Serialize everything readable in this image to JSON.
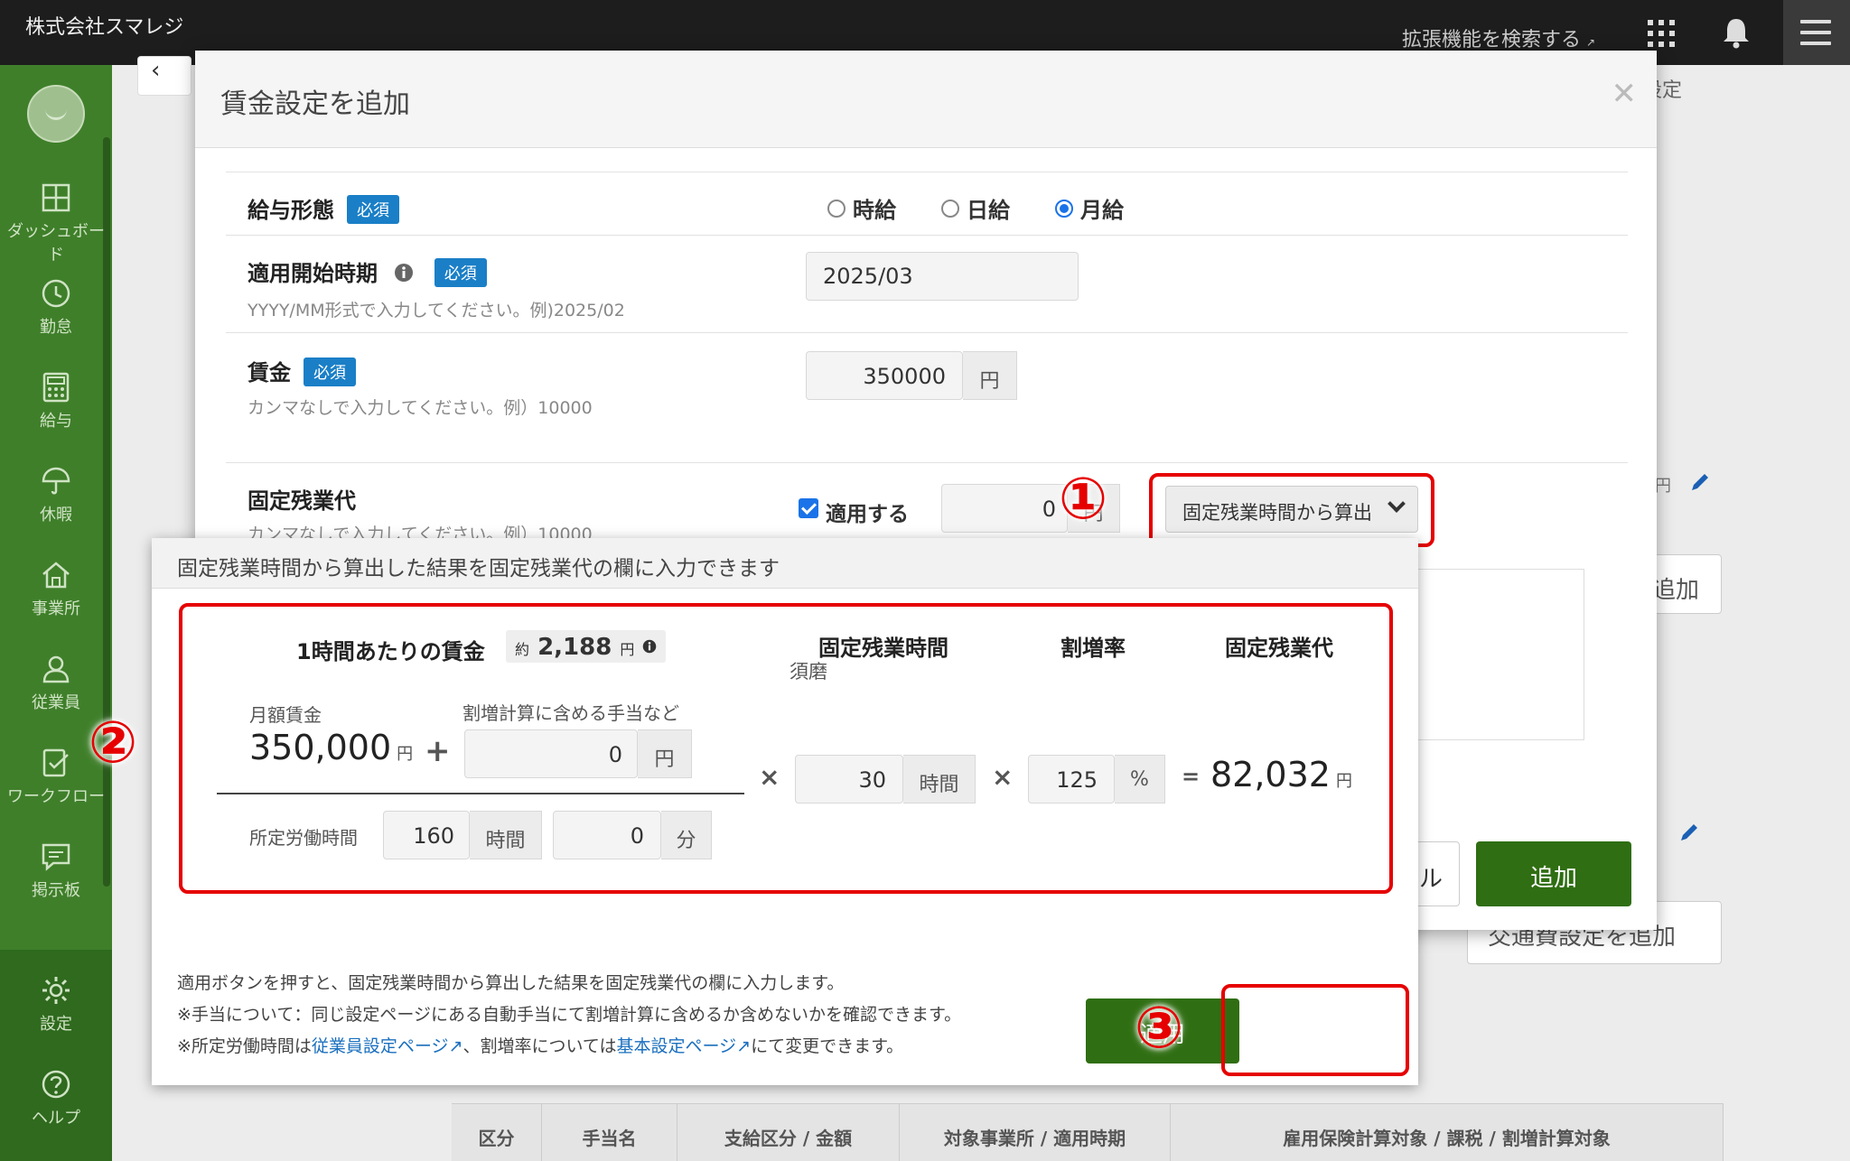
{
  "header": {
    "company": "株式会社スマレジ",
    "ext_search": "拡張機能を検索する"
  },
  "sidebar": {
    "items": [
      {
        "label": "ダッシュボード",
        "icon": "dashboard-icon"
      },
      {
        "label": "勤怠",
        "icon": "clock-icon"
      },
      {
        "label": "給与",
        "icon": "calculator-icon"
      },
      {
        "label": "休暇",
        "icon": "umbrella-icon"
      },
      {
        "label": "事業所",
        "icon": "home-icon"
      },
      {
        "label": "従業員",
        "icon": "person-icon"
      },
      {
        "label": "ワークフロー",
        "icon": "workflow-icon"
      },
      {
        "label": "掲示板",
        "icon": "chat-icon"
      },
      {
        "label": "設定",
        "icon": "gear-icon"
      },
      {
        "label": "ヘルプ",
        "icon": "help-icon"
      }
    ]
  },
  "background": {
    "tab_label": "設定",
    "add_label": "追加",
    "transport_add_label": "交通費設定を追加",
    "yen_fragment": "円",
    "table_headers": [
      "区分",
      "手当名",
      "支給区分 / 金額",
      "対象事業所 / 適用時期",
      "雇用保険計算対象 / 課税 / 割増計算対象"
    ]
  },
  "modal": {
    "title": "賃金設定を追加",
    "salary_type": {
      "label": "給与形態",
      "required": "必須",
      "options": [
        "時給",
        "日給",
        "月給"
      ],
      "selected": "月給"
    },
    "start_period": {
      "label": "適用開始時期",
      "required": "必須",
      "hint": "YYYY/MM形式で入力してください。例)2025/02",
      "value": "2025/03"
    },
    "wage": {
      "label": "賃金",
      "required": "必須",
      "hint": "カンマなしで入力してください。例）10000",
      "value": "350000",
      "unit": "円"
    },
    "fixed_overtime": {
      "label": "固定残業代",
      "hint": "カンマなしで入力してください。例）10000",
      "apply_label": "適用する",
      "value": "0",
      "unit": "円",
      "dropdown": "固定残業時間から算出"
    },
    "cancel_fragment": "ル",
    "add_button": "追加"
  },
  "popover": {
    "header": "固定残業時間から算出した結果を固定残業代の欄に入力できます",
    "hourly_wage_label": "1時間あたりの賃金",
    "approx_prefix": "約",
    "approx_value": "2,188",
    "approx_unit": "円",
    "col_hours": "固定残業時間",
    "col_hours_sub": "須磨",
    "col_rate": "割増率",
    "col_result": "固定残業代",
    "monthly_wage_label": "月額賃金",
    "monthly_wage_value": "350,000",
    "yen": "円",
    "allowance_label": "割増計算に含める手当など",
    "allowance_value": "0",
    "hours_value": "30",
    "hours_unit": "時間",
    "rate_value": "125",
    "rate_unit": "%",
    "result_value": "82,032",
    "work_hours_label": "所定労働時間",
    "work_hours_value": "160",
    "work_minutes_value": "0",
    "minutes_unit": "分",
    "note1": "適用ボタンを押すと、固定残業時間から算出した結果を固定残業代の欄に入力します。",
    "note2": "※手当について：同じ設定ページにある自動手当にて割増計算に含めるか含めないかを確認できます。",
    "note3_a": "※所定労働時間は",
    "note3_link1": "従業員設定ページ",
    "note3_b": "、割増率については",
    "note3_link2": "基本設定ページ",
    "note3_c": "にて変更できます。",
    "apply_button": "適用"
  },
  "annotations": [
    "①",
    "②",
    "③"
  ],
  "colors": {
    "sidebar": "#3f7f2a",
    "topbar": "#1d1d1d",
    "primary_button": "#2f6e12",
    "required_badge": "#1a7fc7",
    "annotation_red": "#e60000"
  }
}
